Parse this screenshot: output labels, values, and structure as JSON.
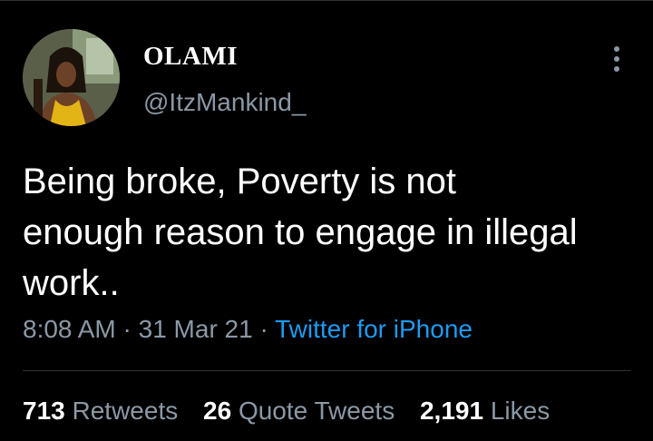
{
  "tweet": {
    "author": {
      "display_name": "OLAMI",
      "handle": "@ItzMankind_"
    },
    "text": "Being broke, Poverty is not\nenough reason to engage in illegal\nwork..",
    "time": "8:08 AM",
    "separator": "·",
    "date": "31 Mar 21",
    "source": "Twitter for iPhone",
    "stats": {
      "retweets_count": "713",
      "retweets_label": "Retweets",
      "quote_count": "26",
      "quote_label": "Quote Tweets",
      "likes_count": "2,191",
      "likes_label": "Likes"
    },
    "menu_icon": "more-vertical-icon"
  },
  "colors": {
    "background": "#000000",
    "primary_text": "#ffffff",
    "secondary_text": "#8b98a5",
    "link": "#1d9bf0",
    "divider": "#2f3336"
  }
}
